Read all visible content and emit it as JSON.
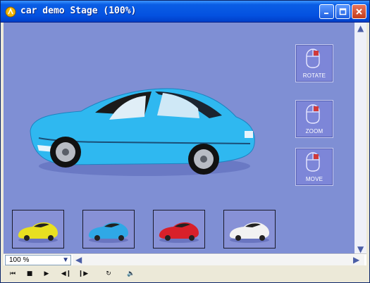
{
  "window": {
    "title": "car demo Stage (100%)",
    "buttons": [
      "minimize",
      "maximize",
      "close"
    ]
  },
  "controls": [
    {
      "label": "ROTATE",
      "icon": "mouse-icon"
    },
    {
      "label": "ZOOM",
      "icon": "mouse-icon"
    },
    {
      "label": "MOVE",
      "icon": "mouse-icon"
    }
  ],
  "color_swatches": [
    {
      "name": "yellow",
      "color": "#e8e020"
    },
    {
      "name": "blue",
      "color": "#2fa8e6"
    },
    {
      "name": "red",
      "color": "#d8202a"
    },
    {
      "name": "white",
      "color": "#f2f2f2"
    }
  ],
  "car": {
    "color": "#2fb8f0"
  },
  "stage_background": "#7f8fd4",
  "zoom": {
    "value": "100 %"
  },
  "playback": {
    "buttons": [
      "rewind-icon",
      "stop-icon",
      "play-icon",
      "step-back-icon",
      "step-forward-icon",
      "loop-icon",
      "volume-icon"
    ]
  }
}
